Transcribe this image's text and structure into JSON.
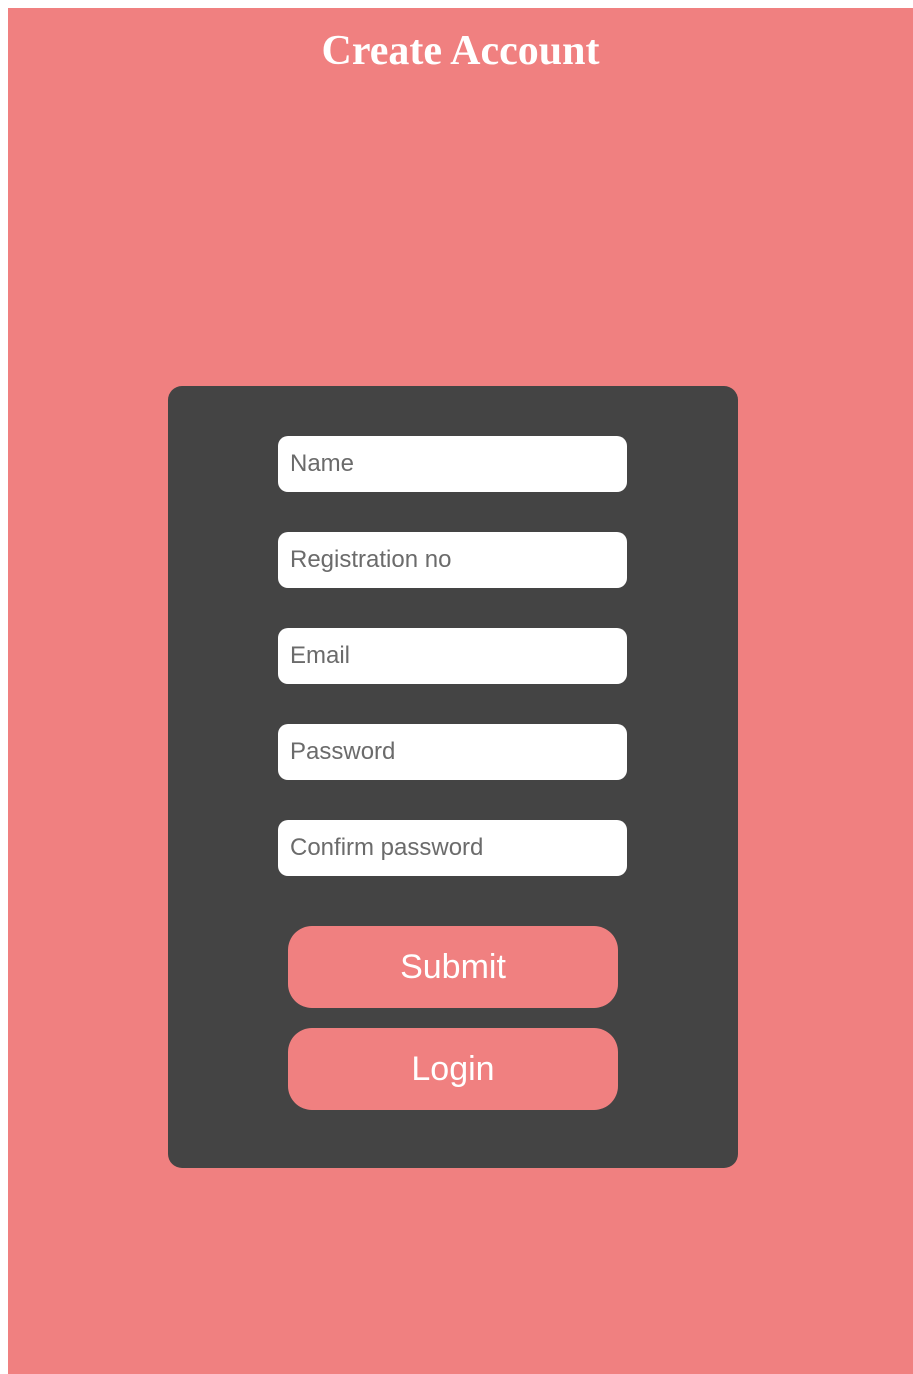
{
  "header": {
    "title": "Create Account"
  },
  "form": {
    "fields": {
      "name": {
        "placeholder": "Name",
        "value": ""
      },
      "registration": {
        "placeholder": "Registration no",
        "value": ""
      },
      "email": {
        "placeholder": "Email",
        "value": ""
      },
      "password": {
        "placeholder": "Password",
        "value": ""
      },
      "confirm_password": {
        "placeholder": "Confirm password",
        "value": ""
      }
    },
    "submit_label": "Submit",
    "login_label": "Login"
  },
  "colors": {
    "background": "#f08080",
    "card": "#444444",
    "button": "#f08080",
    "text_light": "#ffffff"
  }
}
